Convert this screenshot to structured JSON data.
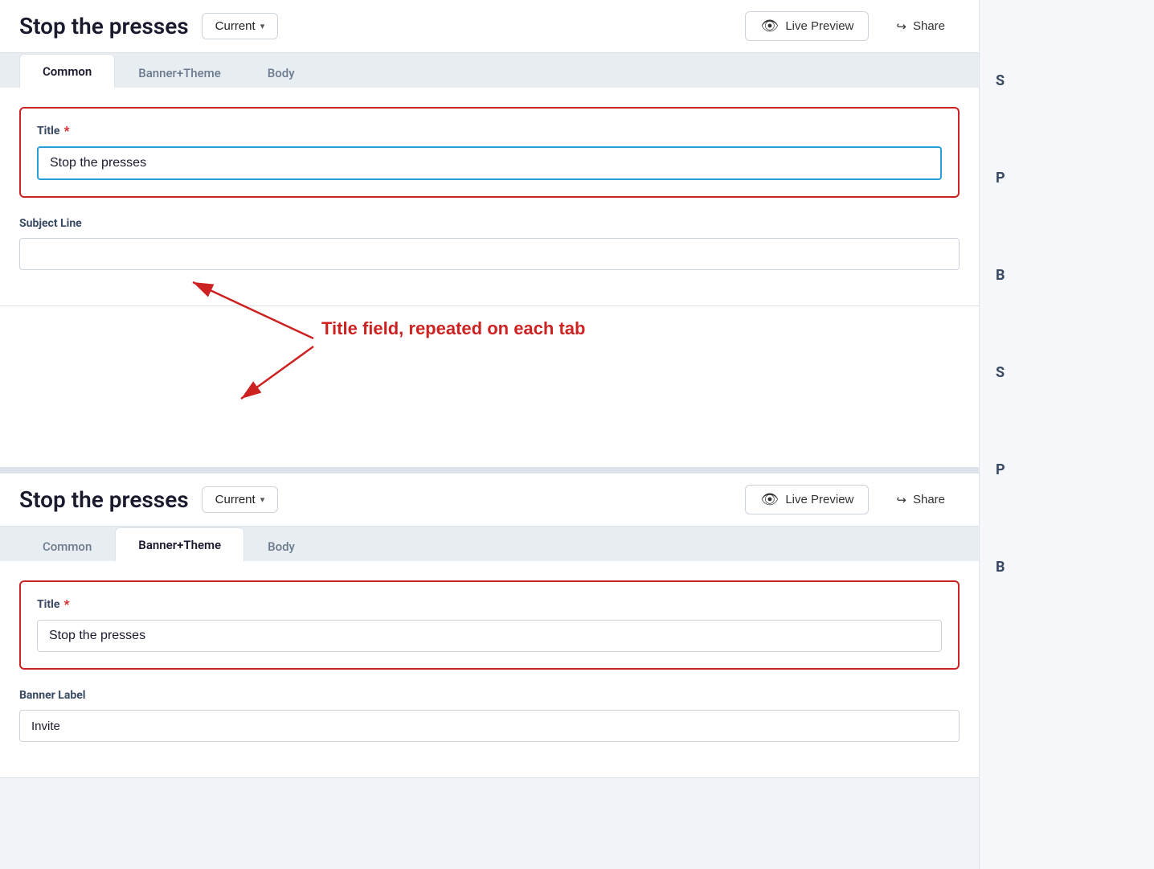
{
  "app": {
    "title": "Stop the presses"
  },
  "header": {
    "title": "Stop the presses",
    "current_label": "Current",
    "live_preview_label": "Live Preview",
    "share_label": "Share"
  },
  "tabs_top": {
    "items": [
      {
        "id": "common",
        "label": "Common",
        "active": true
      },
      {
        "id": "banner-theme",
        "label": "Banner+Theme",
        "active": false
      },
      {
        "id": "body",
        "label": "Body",
        "active": false
      }
    ]
  },
  "tabs_bottom": {
    "items": [
      {
        "id": "common",
        "label": "Common",
        "active": false
      },
      {
        "id": "banner-theme",
        "label": "Banner+Theme",
        "active": true
      },
      {
        "id": "body",
        "label": "Body",
        "active": false
      }
    ]
  },
  "form_top": {
    "title_label": "Title",
    "title_required": "*",
    "title_value": "Stop the presses",
    "subject_label": "Subject Line",
    "subject_value": "",
    "subject_placeholder": ""
  },
  "form_bottom": {
    "title_label": "Title",
    "title_required": "*",
    "title_value": "Stop the presses",
    "banner_label": "Banner Label",
    "banner_value": "Invite"
  },
  "annotation": {
    "text": "Title field, repeated on each tab"
  },
  "right_panel": {
    "letters_top": [
      "S",
      "P",
      "B"
    ],
    "letters_bottom": [
      "S",
      "P",
      "B"
    ]
  }
}
